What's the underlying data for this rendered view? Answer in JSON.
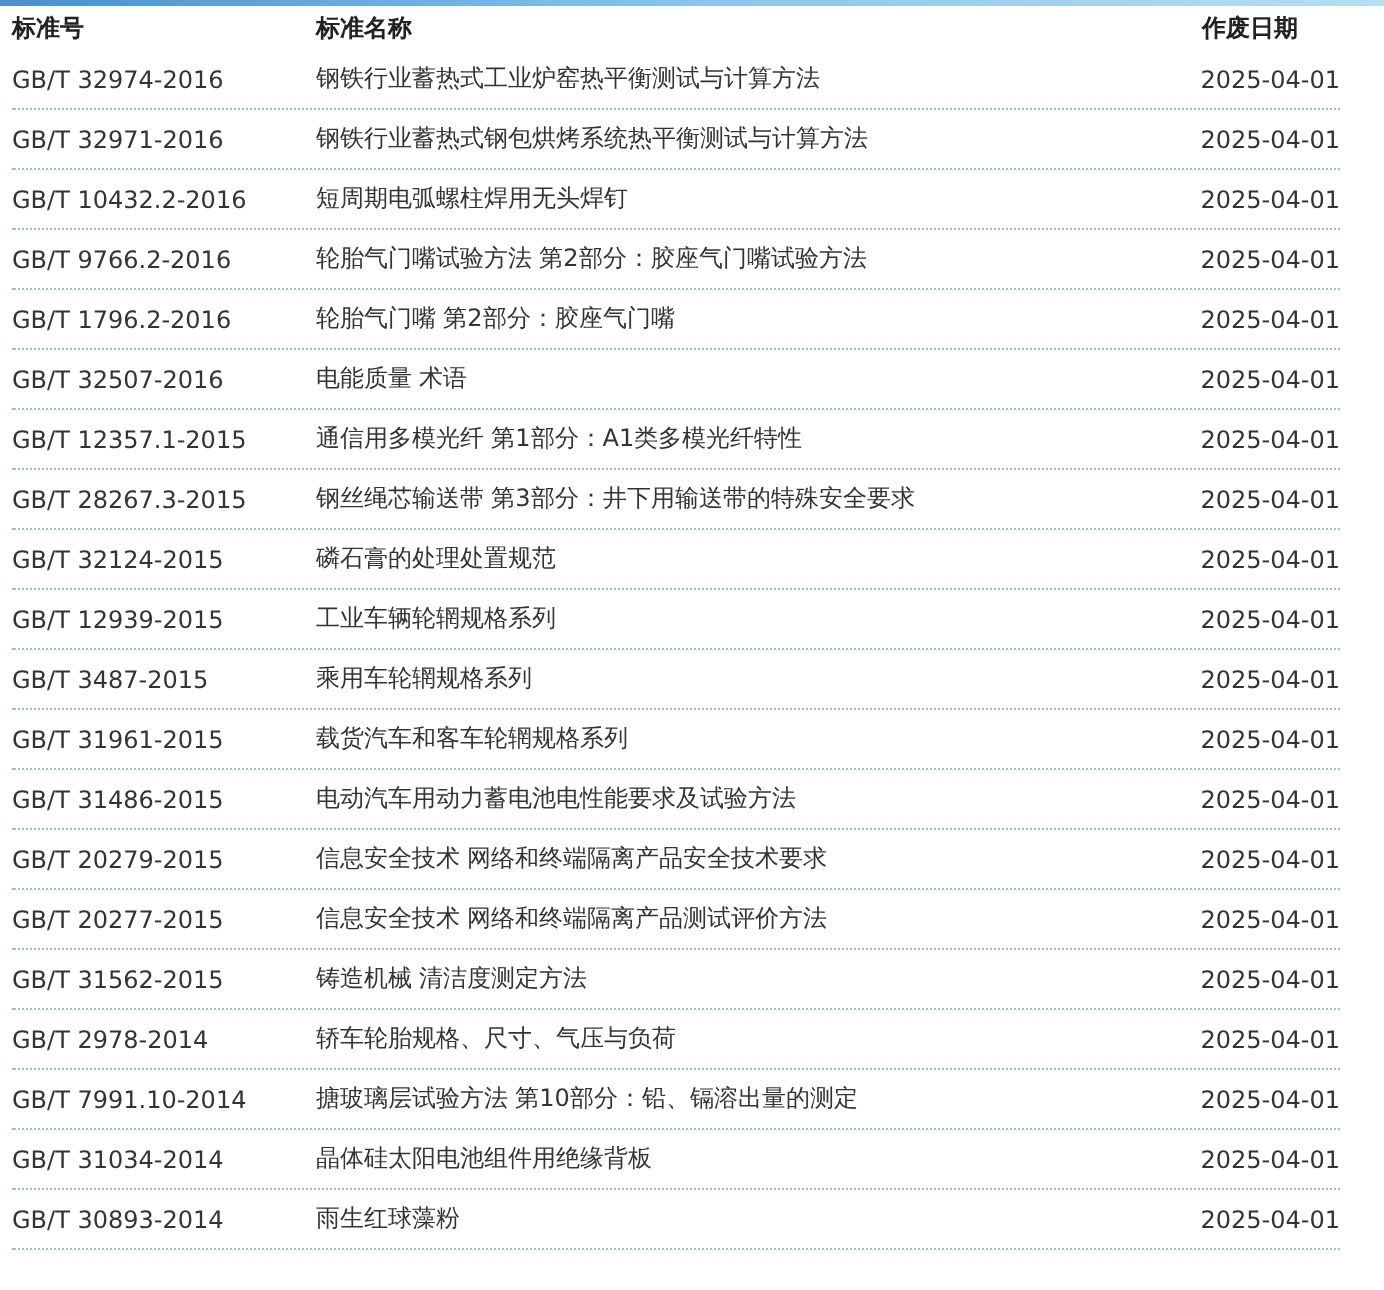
{
  "table": {
    "columns": [
      "标准号",
      "标准名称",
      "作废日期"
    ],
    "rows": [
      {
        "code": "GB/T 32974-2016",
        "name": "钢铁行业蓄热式工业炉窑热平衡测试与计算方法",
        "date": "2025-04-01"
      },
      {
        "code": "GB/T 32971-2016",
        "name": "钢铁行业蓄热式钢包烘烤系统热平衡测试与计算方法",
        "date": "2025-04-01"
      },
      {
        "code": "GB/T 10432.2-2016",
        "name": "短周期电弧螺柱焊用无头焊钉",
        "date": "2025-04-01"
      },
      {
        "code": "GB/T 9766.2-2016",
        "name": "轮胎气门嘴试验方法 第2部分：胶座气门嘴试验方法",
        "date": "2025-04-01"
      },
      {
        "code": "GB/T 1796.2-2016",
        "name": "轮胎气门嘴 第2部分：胶座气门嘴",
        "date": "2025-04-01"
      },
      {
        "code": "GB/T 32507-2016",
        "name": "电能质量 术语",
        "date": "2025-04-01"
      },
      {
        "code": "GB/T 12357.1-2015",
        "name": "通信用多模光纤 第1部分：A1类多模光纤特性",
        "date": "2025-04-01"
      },
      {
        "code": "GB/T 28267.3-2015",
        "name": "钢丝绳芯输送带 第3部分：井下用输送带的特殊安全要求",
        "date": "2025-04-01"
      },
      {
        "code": "GB/T 32124-2015",
        "name": "磷石膏的处理处置规范",
        "date": "2025-04-01"
      },
      {
        "code": "GB/T 12939-2015",
        "name": "工业车辆轮辋规格系列",
        "date": "2025-04-01"
      },
      {
        "code": "GB/T 3487-2015",
        "name": "乘用车轮辋规格系列",
        "date": "2025-04-01"
      },
      {
        "code": "GB/T 31961-2015",
        "name": "载货汽车和客车轮辋规格系列",
        "date": "2025-04-01"
      },
      {
        "code": "GB/T 31486-2015",
        "name": "电动汽车用动力蓄电池电性能要求及试验方法",
        "date": "2025-04-01"
      },
      {
        "code": "GB/T 20279-2015",
        "name": "信息安全技术 网络和终端隔离产品安全技术要求",
        "date": "2025-04-01"
      },
      {
        "code": "GB/T 20277-2015",
        "name": "信息安全技术 网络和终端隔离产品测试评价方法",
        "date": "2025-04-01"
      },
      {
        "code": "GB/T 31562-2015",
        "name": "铸造机械 清洁度测定方法",
        "date": "2025-04-01"
      },
      {
        "code": "GB/T 2978-2014",
        "name": "轿车轮胎规格、尺寸、气压与负荷",
        "date": "2025-04-01"
      },
      {
        "code": "GB/T 7991.10-2014",
        "name": "搪玻璃层试验方法 第10部分：铅、镉溶出量的测定",
        "date": "2025-04-01"
      },
      {
        "code": "GB/T 31034-2014",
        "name": "晶体硅太阳电池组件用绝缘背板",
        "date": "2025-04-01"
      },
      {
        "code": "GB/T 30893-2014",
        "name": "雨生红球藻粉",
        "date": "2025-04-01"
      }
    ]
  }
}
